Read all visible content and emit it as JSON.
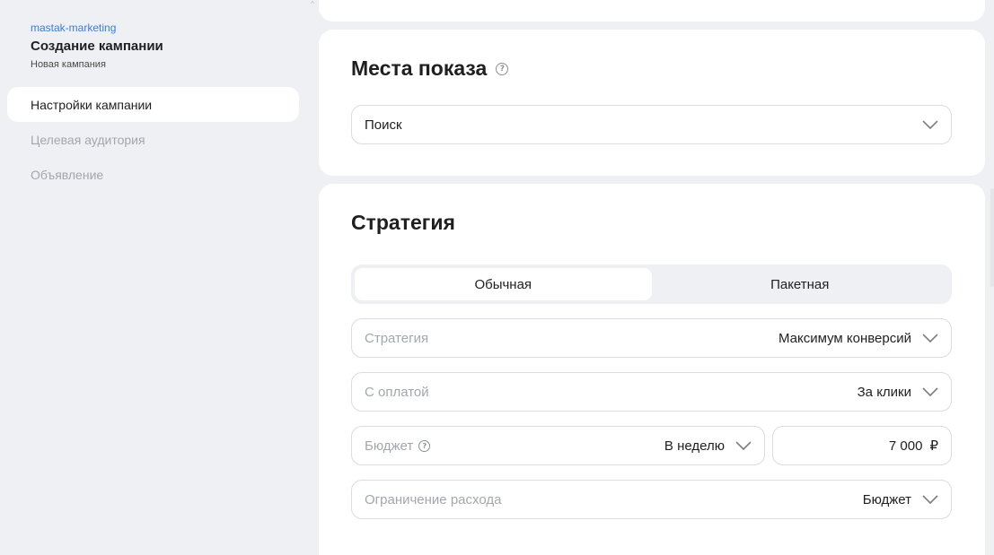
{
  "sidebar": {
    "account": "mastak-marketing",
    "title": "Создание кампании",
    "subtitle": "Новая кампания",
    "items": [
      {
        "label": "Настройки кампании",
        "active": true
      },
      {
        "label": "Целевая аудитория",
        "active": false
      },
      {
        "label": "Объявление",
        "active": false
      }
    ]
  },
  "places": {
    "title": "Места показа",
    "help_icon": "question-circle-icon",
    "select_value": "Поиск"
  },
  "strategy": {
    "title": "Стратегия",
    "tabs": [
      {
        "label": "Обычная",
        "active": true
      },
      {
        "label": "Пакетная",
        "active": false
      }
    ],
    "fields": {
      "strategy": {
        "label": "Стратегия",
        "value": "Максимум конверсий"
      },
      "payment": {
        "label": "С оплатой",
        "value": "За клики"
      },
      "budget": {
        "label": "Бюджет",
        "period": "В неделю",
        "amount": "7 000",
        "currency": "₽"
      },
      "spend_limit": {
        "label": "Ограничение расхода",
        "value": "Бюджет"
      }
    }
  },
  "colors": {
    "background": "#eef0f3",
    "card": "#ffffff",
    "account_link": "#3a7be0",
    "muted_text": "#a3a7ad"
  }
}
